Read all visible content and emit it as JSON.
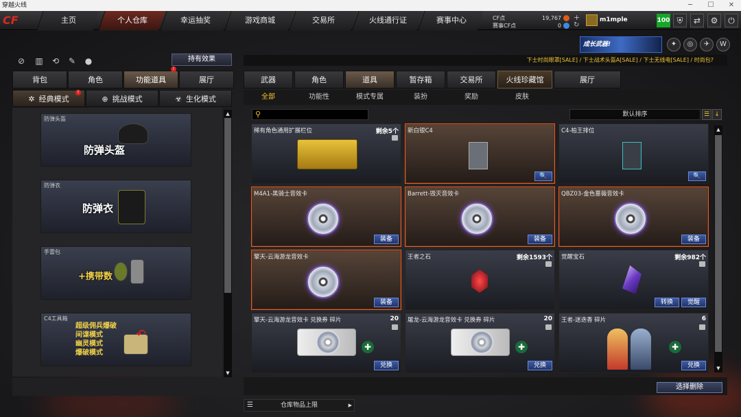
{
  "window": {
    "title": "穿越火线"
  },
  "nav": {
    "tabs": [
      "主页",
      "个人仓库",
      "幸运抽奖",
      "游戏商城",
      "交易所",
      "火线通行证",
      "赛事中心"
    ]
  },
  "account": {
    "cf_label": "CF点",
    "cf_value": "19,767",
    "event_label": "赛事CF点",
    "event_value": "0",
    "username": "m1mple",
    "level": "100"
  },
  "banner": {
    "text": "成长武器!"
  },
  "marquee": "下士时尚眼罩[SALE] / 下士战术头盔A[SALE] / 下士无线电[SALE] / 时尚包?",
  "left": {
    "effect_button": "持有效果",
    "tabs": [
      "背包",
      "角色",
      "功能道具",
      "展厅"
    ],
    "mode_tabs": [
      "经典模式",
      "挑战模式",
      "生化模式"
    ],
    "cards": [
      {
        "title": "防弹头盔",
        "big": "防弹头盔"
      },
      {
        "title": "防弹衣",
        "big": "防弹衣"
      },
      {
        "title": "手雷包",
        "big": "+携带数"
      },
      {
        "title": "C4工具箱",
        "lines": [
          "超级佣兵爆破",
          "间谍模式",
          "幽灵模式",
          "爆破模式"
        ]
      }
    ]
  },
  "right": {
    "tabs": [
      "武器",
      "角色",
      "道具",
      "暂存箱",
      "交易所",
      "火线珍藏馆",
      "展厅"
    ],
    "subtabs": [
      "全部",
      "功能性",
      "模式专属",
      "装扮",
      "奖励",
      "皮肤"
    ],
    "search": {
      "placeholder": ""
    },
    "sort": "默认排序",
    "items": [
      {
        "name": "稀有角色通用扩展栏位",
        "count": "剩余5个"
      },
      {
        "name": "新白银C4",
        "button": "🔍"
      },
      {
        "name": "C4-柏王排位",
        "button": "🔍"
      },
      {
        "name": "M4A1-黑骑士音效卡",
        "button": "装备"
      },
      {
        "name": "Barrett-毁灭音效卡",
        "button": "装备"
      },
      {
        "name": "QBZ03-金色蔷薇音效卡",
        "button": "装备"
      },
      {
        "name": "擎天-云海游龙音效卡",
        "button": "装备"
      },
      {
        "name": "王者之石",
        "count": "剩余1593个"
      },
      {
        "name": "觉醒宝石",
        "count": "剩余982个",
        "button": "觉醒",
        "button2": "转换"
      },
      {
        "name": "擎天-云海游龙音效卡 兑换券 碎片",
        "count": "20",
        "button": "兑换"
      },
      {
        "name": "屠龙-云海游龙音效卡 兑换券 碎片",
        "count": "20",
        "button": "兑换"
      },
      {
        "name": "王者-迷迭香 碎片",
        "count": "6",
        "button": "兑换"
      }
    ],
    "delete_button": "选择删除",
    "capacity": "仓库物品上限"
  }
}
